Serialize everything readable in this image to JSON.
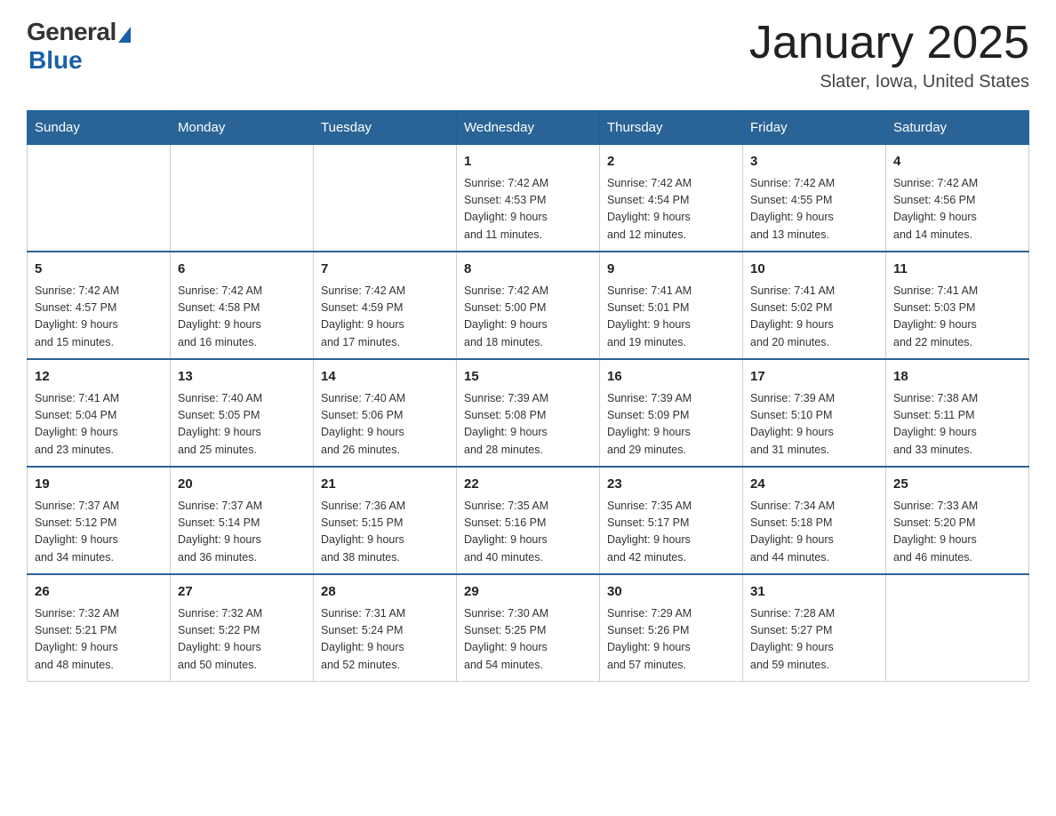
{
  "header": {
    "logo_general": "General",
    "logo_blue": "Blue",
    "month_title": "January 2025",
    "location": "Slater, Iowa, United States"
  },
  "days_of_week": [
    "Sunday",
    "Monday",
    "Tuesday",
    "Wednesday",
    "Thursday",
    "Friday",
    "Saturday"
  ],
  "weeks": [
    [
      {
        "day": "",
        "info": ""
      },
      {
        "day": "",
        "info": ""
      },
      {
        "day": "",
        "info": ""
      },
      {
        "day": "1",
        "info": "Sunrise: 7:42 AM\nSunset: 4:53 PM\nDaylight: 9 hours\nand 11 minutes."
      },
      {
        "day": "2",
        "info": "Sunrise: 7:42 AM\nSunset: 4:54 PM\nDaylight: 9 hours\nand 12 minutes."
      },
      {
        "day": "3",
        "info": "Sunrise: 7:42 AM\nSunset: 4:55 PM\nDaylight: 9 hours\nand 13 minutes."
      },
      {
        "day": "4",
        "info": "Sunrise: 7:42 AM\nSunset: 4:56 PM\nDaylight: 9 hours\nand 14 minutes."
      }
    ],
    [
      {
        "day": "5",
        "info": "Sunrise: 7:42 AM\nSunset: 4:57 PM\nDaylight: 9 hours\nand 15 minutes."
      },
      {
        "day": "6",
        "info": "Sunrise: 7:42 AM\nSunset: 4:58 PM\nDaylight: 9 hours\nand 16 minutes."
      },
      {
        "day": "7",
        "info": "Sunrise: 7:42 AM\nSunset: 4:59 PM\nDaylight: 9 hours\nand 17 minutes."
      },
      {
        "day": "8",
        "info": "Sunrise: 7:42 AM\nSunset: 5:00 PM\nDaylight: 9 hours\nand 18 minutes."
      },
      {
        "day": "9",
        "info": "Sunrise: 7:41 AM\nSunset: 5:01 PM\nDaylight: 9 hours\nand 19 minutes."
      },
      {
        "day": "10",
        "info": "Sunrise: 7:41 AM\nSunset: 5:02 PM\nDaylight: 9 hours\nand 20 minutes."
      },
      {
        "day": "11",
        "info": "Sunrise: 7:41 AM\nSunset: 5:03 PM\nDaylight: 9 hours\nand 22 minutes."
      }
    ],
    [
      {
        "day": "12",
        "info": "Sunrise: 7:41 AM\nSunset: 5:04 PM\nDaylight: 9 hours\nand 23 minutes."
      },
      {
        "day": "13",
        "info": "Sunrise: 7:40 AM\nSunset: 5:05 PM\nDaylight: 9 hours\nand 25 minutes."
      },
      {
        "day": "14",
        "info": "Sunrise: 7:40 AM\nSunset: 5:06 PM\nDaylight: 9 hours\nand 26 minutes."
      },
      {
        "day": "15",
        "info": "Sunrise: 7:39 AM\nSunset: 5:08 PM\nDaylight: 9 hours\nand 28 minutes."
      },
      {
        "day": "16",
        "info": "Sunrise: 7:39 AM\nSunset: 5:09 PM\nDaylight: 9 hours\nand 29 minutes."
      },
      {
        "day": "17",
        "info": "Sunrise: 7:39 AM\nSunset: 5:10 PM\nDaylight: 9 hours\nand 31 minutes."
      },
      {
        "day": "18",
        "info": "Sunrise: 7:38 AM\nSunset: 5:11 PM\nDaylight: 9 hours\nand 33 minutes."
      }
    ],
    [
      {
        "day": "19",
        "info": "Sunrise: 7:37 AM\nSunset: 5:12 PM\nDaylight: 9 hours\nand 34 minutes."
      },
      {
        "day": "20",
        "info": "Sunrise: 7:37 AM\nSunset: 5:14 PM\nDaylight: 9 hours\nand 36 minutes."
      },
      {
        "day": "21",
        "info": "Sunrise: 7:36 AM\nSunset: 5:15 PM\nDaylight: 9 hours\nand 38 minutes."
      },
      {
        "day": "22",
        "info": "Sunrise: 7:35 AM\nSunset: 5:16 PM\nDaylight: 9 hours\nand 40 minutes."
      },
      {
        "day": "23",
        "info": "Sunrise: 7:35 AM\nSunset: 5:17 PM\nDaylight: 9 hours\nand 42 minutes."
      },
      {
        "day": "24",
        "info": "Sunrise: 7:34 AM\nSunset: 5:18 PM\nDaylight: 9 hours\nand 44 minutes."
      },
      {
        "day": "25",
        "info": "Sunrise: 7:33 AM\nSunset: 5:20 PM\nDaylight: 9 hours\nand 46 minutes."
      }
    ],
    [
      {
        "day": "26",
        "info": "Sunrise: 7:32 AM\nSunset: 5:21 PM\nDaylight: 9 hours\nand 48 minutes."
      },
      {
        "day": "27",
        "info": "Sunrise: 7:32 AM\nSunset: 5:22 PM\nDaylight: 9 hours\nand 50 minutes."
      },
      {
        "day": "28",
        "info": "Sunrise: 7:31 AM\nSunset: 5:24 PM\nDaylight: 9 hours\nand 52 minutes."
      },
      {
        "day": "29",
        "info": "Sunrise: 7:30 AM\nSunset: 5:25 PM\nDaylight: 9 hours\nand 54 minutes."
      },
      {
        "day": "30",
        "info": "Sunrise: 7:29 AM\nSunset: 5:26 PM\nDaylight: 9 hours\nand 57 minutes."
      },
      {
        "day": "31",
        "info": "Sunrise: 7:28 AM\nSunset: 5:27 PM\nDaylight: 9 hours\nand 59 minutes."
      },
      {
        "day": "",
        "info": ""
      }
    ]
  ]
}
